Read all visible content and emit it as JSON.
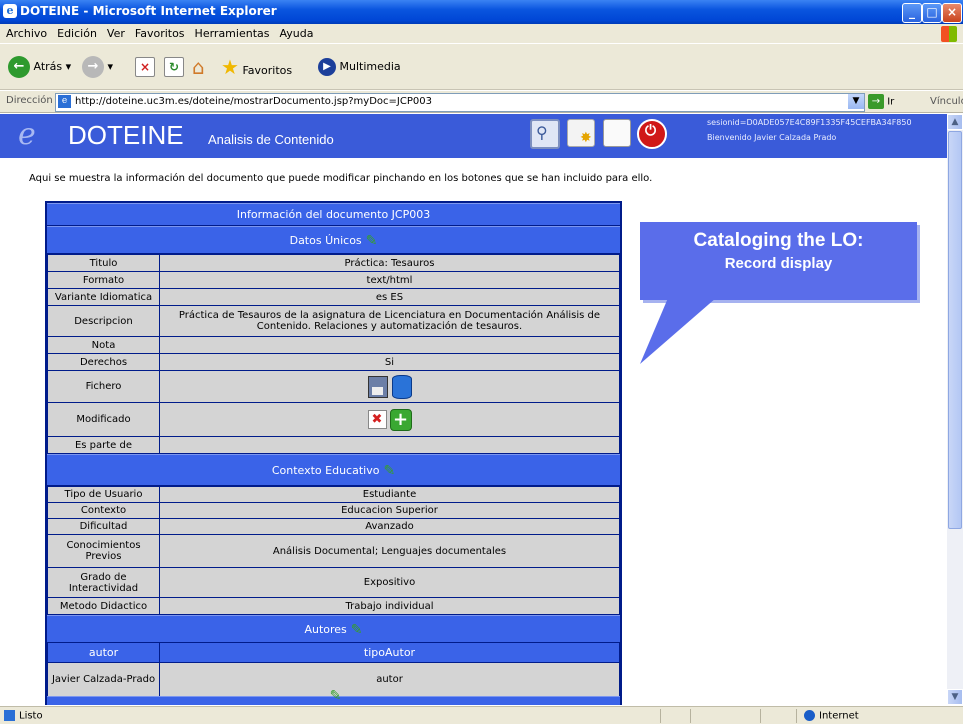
{
  "window": {
    "title": "DOTEINE - Microsoft Internet Explorer"
  },
  "menu": [
    "Archivo",
    "Edición",
    "Ver",
    "Favoritos",
    "Herramientas",
    "Ayuda"
  ],
  "toolbar": {
    "back": "Atrás",
    "favorites": "Favoritos",
    "multimedia": "Multimedia"
  },
  "address": {
    "label": "Dirección",
    "url": "http://doteine.uc3m.es/doteine/mostrarDocumento.jsp?myDoc=JCP003",
    "go": "Ir",
    "links": "Vínculos"
  },
  "header": {
    "title": "DOTEINE",
    "subtitle": "Analisis de Contenido",
    "session": "sesionid=D0ADE057E4C89F1335F45CEFBA34F850",
    "welcome": "Bienvenido Javier Calzada Prado"
  },
  "intro": "Aqui se muestra la información del documento que puede modificar pinchando en los botones que se han incluido para ello.",
  "doc": {
    "title": "Información del documento JCP003",
    "sections": {
      "unique": "Datos Únicos",
      "edu": "Contexto Educativo",
      "authors": "Autores"
    },
    "unique_fields": [
      {
        "k": "Titulo",
        "v": "Práctica: Tesauros"
      },
      {
        "k": "Formato",
        "v": "text/html"
      },
      {
        "k": "Variante Idiomatica",
        "v": "es ES"
      },
      {
        "k": "Descripcion",
        "v": "Práctica de Tesauros de la asignatura de Licenciatura en Documentación Análisis de Contenido. Relaciones y automatización de tesauros."
      },
      {
        "k": "Nota",
        "v": ""
      },
      {
        "k": "Derechos",
        "v": "Si"
      },
      {
        "k": "Fichero",
        "v": ""
      },
      {
        "k": "Modificado",
        "v": ""
      },
      {
        "k": "Es parte de",
        "v": ""
      }
    ],
    "edu_fields": [
      {
        "k": "Tipo de Usuario",
        "v": "Estudiante"
      },
      {
        "k": "Contexto",
        "v": "Educacion Superior"
      },
      {
        "k": "Dificultad",
        "v": "Avanzado"
      },
      {
        "k": "Conocimientos Previos",
        "v": "Análisis Documental; Lenguajes documentales"
      },
      {
        "k": "Grado de Interactividad",
        "v": "Expositivo"
      },
      {
        "k": "Metodo Didactico",
        "v": "Trabajo individual"
      }
    ],
    "author_cols": {
      "k": "autor",
      "v": "tipoAutor"
    },
    "authors": [
      {
        "k": "Javier Calzada-Prado",
        "v": "autor"
      }
    ]
  },
  "callout": {
    "line1": "Cataloging the LO:",
    "line2": "Record display"
  },
  "status": {
    "text": "Listo",
    "zone": "Internet"
  },
  "icons": {
    "search": "magnifier-icon",
    "new": "new-document-icon",
    "copy": "copy-icon",
    "power": "power-icon",
    "save": "floppy-icon",
    "db": "database-icon",
    "delete": "delete-icon",
    "add": "add-icon",
    "edit": "pencil-icon"
  }
}
